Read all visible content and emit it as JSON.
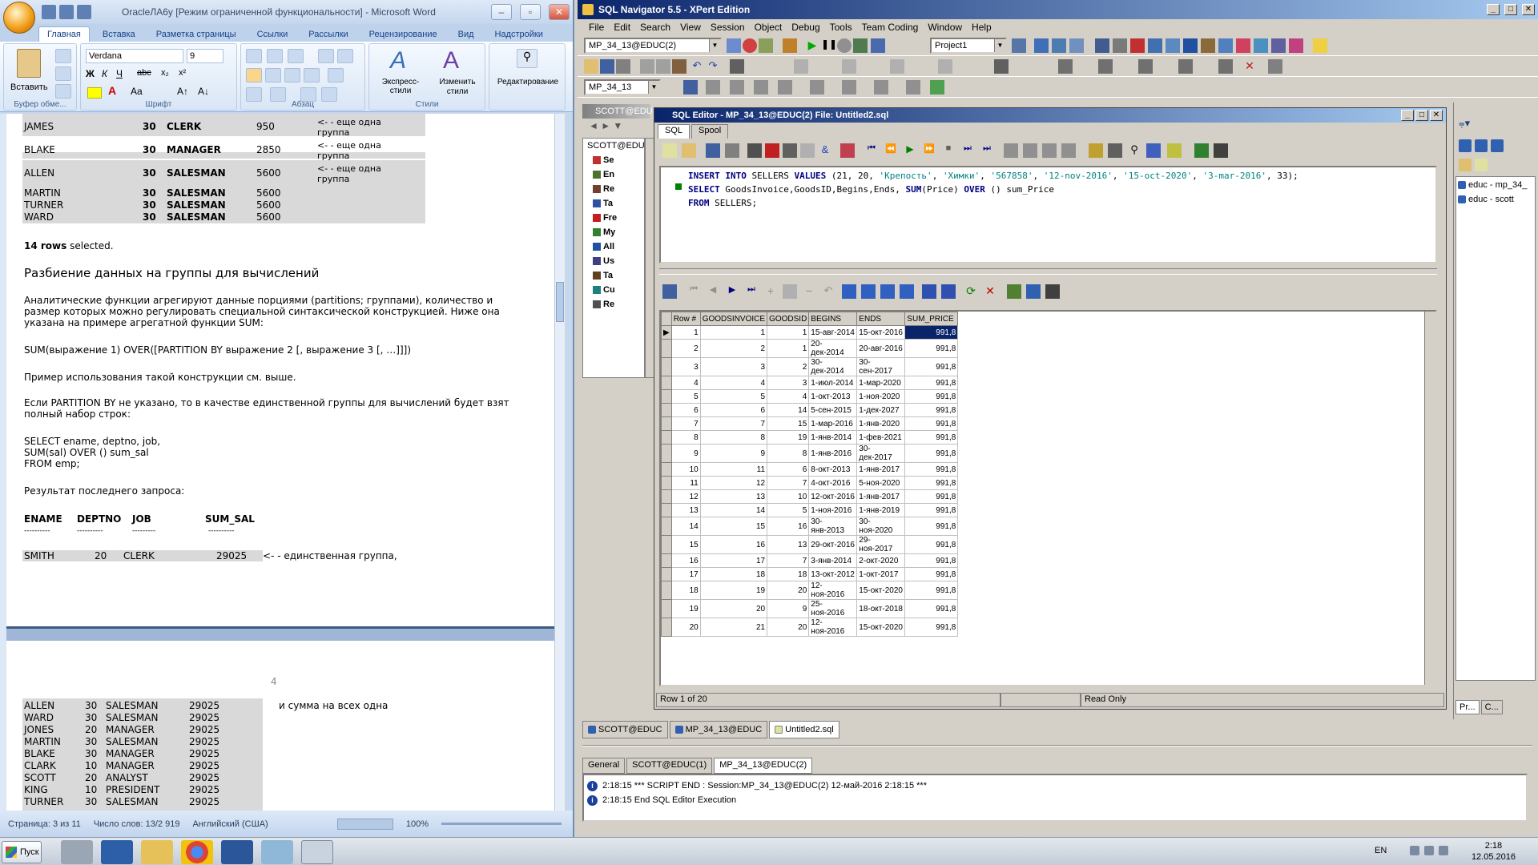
{
  "word": {
    "title": "OracleЛА6у [Режим ограниченной функциональности] - Microsoft Word",
    "tabs": [
      "Главная",
      "Вставка",
      "Разметка страницы",
      "Ссылки",
      "Рассылки",
      "Рецензирование",
      "Вид",
      "Надстройки"
    ],
    "font_name": "Verdana",
    "font_size": "9",
    "paste_label": "Вставить",
    "groups": {
      "clipboard": "Буфер обме...",
      "font": "Шрифт",
      "paragraph": "Абзац",
      "styles": "Стили",
      "editing": "Редактирование"
    },
    "express_styles": "Экспресс-стили",
    "change_styles": "Изменить стили",
    "top_rows": [
      {
        "name": "JAMES",
        "dept": "30",
        "job": "CLERK",
        "sal": "950",
        "note": "<- - еще одна группа"
      },
      {
        "name": "BLAKE",
        "dept": "30",
        "job": "MANAGER",
        "sal": "2850",
        "note": "<- - еще одна группа"
      },
      {
        "name": "ALLEN",
        "dept": "30",
        "job": "SALESMAN",
        "sal": "5600",
        "note": "<- - еще одна группа"
      },
      {
        "name": "MARTIN",
        "dept": "30",
        "job": "SALESMAN",
        "sal": "5600",
        "note": ""
      },
      {
        "name": "TURNER",
        "dept": "30",
        "job": "SALESMAN",
        "sal": "5600",
        "note": ""
      },
      {
        "name": "WARD",
        "dept": "30",
        "job": "SALESMAN",
        "sal": "5600",
        "note": ""
      }
    ],
    "rows_selected_num": "14 rows",
    "rows_selected_text": " selected.",
    "heading": "Разбиение данных на группы для вычислений",
    "para1_l1": "Аналитические функции агрегируют данные порциями (partitions; группами), количество и",
    "para1_l2": "размер которых можно регулировать специальной синтаксической конструкцией. Ниже она",
    "para1_l3": "указана на примере агрегатной функции SUM:",
    "syntax": "SUM(выражение 1) OVER([PARTITION BY выражение 2 [, выражение 3 [, …]]])",
    "para2": "Пример использования такой конструкции см. выше.",
    "para3_l1": "Если PARTITION BY не указано, то в качестве единственной группы для вычислений будет взят",
    "para3_l2": "полный набор строк:",
    "sql1": "SELECT ename, deptno, job,",
    "sql2": "SUM(sal) OVER () sum_sal",
    "sql3": "FROM emp;",
    "result_label": "Результат последнего запроса:",
    "result_headers": [
      "ENAME",
      "DEPTNO",
      "JOB",
      "SUM_SAL"
    ],
    "dashes": [
      "----------",
      "----------",
      "---------",
      "----------"
    ],
    "smith": {
      "name": "SMITH",
      "dept": "20",
      "job": "CLERK",
      "sum": "29025",
      "note": "<- -  единственная группа,"
    },
    "page_number": "4",
    "page2_note": "и сумма на всех одна",
    "page2_rows": [
      {
        "name": "ALLEN",
        "dept": "30",
        "job": "SALESMAN",
        "sum": "29025"
      },
      {
        "name": "WARD",
        "dept": "30",
        "job": "SALESMAN",
        "sum": "29025"
      },
      {
        "name": "JONES",
        "dept": "20",
        "job": "MANAGER",
        "sum": "29025"
      },
      {
        "name": "MARTIN",
        "dept": "30",
        "job": "SALESMAN",
        "sum": "29025"
      },
      {
        "name": "BLAKE",
        "dept": "30",
        "job": "MANAGER",
        "sum": "29025"
      },
      {
        "name": "CLARK",
        "dept": "10",
        "job": "MANAGER",
        "sum": "29025"
      },
      {
        "name": "SCOTT",
        "dept": "20",
        "job": "ANALYST",
        "sum": "29025"
      },
      {
        "name": "KING",
        "dept": "10",
        "job": "PRESIDENT",
        "sum": "29025"
      },
      {
        "name": "TURNER",
        "dept": "30",
        "job": "SALESMAN",
        "sum": "29025"
      }
    ],
    "status_page": "Страница: 3 из 11",
    "status_words": "Число слов: 13/2 919",
    "status_lang": "Английский (США)",
    "zoom": "100%"
  },
  "sqlnav": {
    "title": "SQL Navigator 5.5 - XPert Edition",
    "menu": [
      "File",
      "Edit",
      "Search",
      "View",
      "Session",
      "Object",
      "Debug",
      "Tools",
      "Team Coding",
      "Window",
      "Help"
    ],
    "session_combo": "MP_34_13@EDUC(2)",
    "project_combo": "Project1",
    "schema_combo": "MP_34_13",
    "db_tab": "SCOTT@EDU",
    "db_tree": [
      "SCOTT@EDUC",
      "Se",
      "En",
      "Re",
      "Ta",
      "Fre",
      "My",
      "All",
      "Us",
      "Ta",
      "Cu",
      "Re"
    ],
    "editor_title": "SQL Editor - MP_34_13@EDUC(2) File: Untitled2.sql",
    "editor_tabs": [
      "SQL",
      "Spool"
    ],
    "code_line1": {
      "k1": "INSERT INTO",
      "t1": " SELLERS ",
      "k2": "VALUES",
      "t2": " (21, 20, ",
      "s1": "'Крепость'",
      "c1": ", ",
      "s2": "'Химки'",
      "c2": ", ",
      "s3": "'567858'",
      "c3": ", ",
      "s4": "'12-nov-2016'",
      "c4": ", ",
      "s5": "'15-oct-2020'",
      "c5": ", ",
      "s6": "'3-mar-2016'",
      "c6": ", 33);"
    },
    "code_line2": {
      "k1": "SELECT",
      "t1": " GoodsInvoice,GoodsID,Begins,Ends, ",
      "k2": "SUM",
      "t2": "(Price) ",
      "k3": "OVER",
      "t3": " () sum_Price"
    },
    "code_line3": {
      "k1": "FROM",
      "t1": " SELLERS;"
    },
    "grid_headers": [
      "Row #",
      "GOODSINVOICE",
      "GOODSID",
      "BEGINS",
      "ENDS",
      "SUM_PRICE"
    ],
    "grid_rows": [
      [
        "1",
        "1",
        "1",
        "15-авг-2014",
        "15-окт-2016",
        "991,8"
      ],
      [
        "2",
        "2",
        "1",
        "20-дек-2014",
        "20-авг-2016",
        "991,8"
      ],
      [
        "3",
        "3",
        "2",
        "30-дек-2014",
        "30-сен-2017",
        "991,8"
      ],
      [
        "4",
        "4",
        "3",
        "1-июл-2014",
        "1-мар-2020",
        "991,8"
      ],
      [
        "5",
        "5",
        "4",
        "1-окт-2013",
        "1-ноя-2020",
        "991,8"
      ],
      [
        "6",
        "6",
        "14",
        "5-сен-2015",
        "1-дек-2027",
        "991,8"
      ],
      [
        "7",
        "7",
        "15",
        "1-мар-2016",
        "1-янв-2020",
        "991,8"
      ],
      [
        "8",
        "8",
        "19",
        "1-янв-2014",
        "1-фев-2021",
        "991,8"
      ],
      [
        "9",
        "9",
        "8",
        "1-янв-2016",
        "30-дек-2017",
        "991,8"
      ],
      [
        "10",
        "11",
        "6",
        "8-окт-2013",
        "1-янв-2017",
        "991,8"
      ],
      [
        "11",
        "12",
        "7",
        "4-окт-2016",
        "5-ноя-2020",
        "991,8"
      ],
      [
        "12",
        "13",
        "10",
        "12-окт-2016",
        "1-янв-2017",
        "991,8"
      ],
      [
        "13",
        "14",
        "5",
        "1-ноя-2016",
        "1-янв-2019",
        "991,8"
      ],
      [
        "14",
        "15",
        "16",
        "30-янв-2013",
        "30-ноя-2020",
        "991,8"
      ],
      [
        "15",
        "16",
        "13",
        "29-окт-2016",
        "29-ноя-2017",
        "991,8"
      ],
      [
        "16",
        "17",
        "7",
        "3-янв-2014",
        "2-окт-2020",
        "991,8"
      ],
      [
        "17",
        "18",
        "18",
        "13-окт-2012",
        "1-окт-2017",
        "991,8"
      ],
      [
        "18",
        "19",
        "20",
        "12-ноя-2016",
        "15-окт-2020",
        "991,8"
      ],
      [
        "19",
        "20",
        "9",
        "25-ноя-2016",
        "18-окт-2018",
        "991,8"
      ],
      [
        "20",
        "21",
        "20",
        "12-ноя-2016",
        "15-окт-2020",
        "991,8"
      ]
    ],
    "status_row": "Row 1 of 20",
    "status_mode": "Read Only",
    "right_items": [
      "educ - mp_34_",
      "educ - scott"
    ],
    "right_bottom_tabs": [
      "Pr...",
      "C..."
    ],
    "doc_tabs": [
      "SCOTT@EDUC",
      "MP_34_13@EDUC",
      "Untitled2.sql"
    ],
    "output_tabs": [
      "General",
      "SCOTT@EDUC(1)",
      "MP_34_13@EDUC(2)"
    ],
    "output_lines": [
      "2:18:15  *** SCRIPT END :  Session:MP_34_13@EDUC(2)   12-май-2016 2:18:15 ***",
      "2:18:15  End SQL Editor Execution"
    ]
  },
  "taskbar": {
    "start": "Пуск",
    "lang": "EN",
    "time": "2:18",
    "date": "12.05.2016"
  }
}
